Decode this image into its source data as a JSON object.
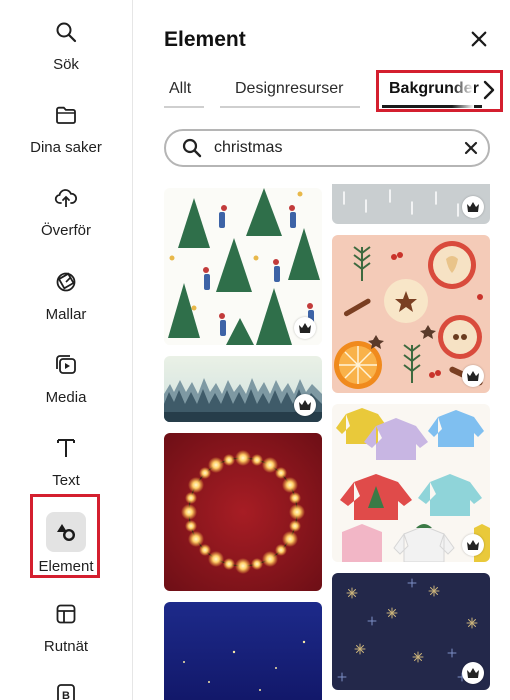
{
  "sidebar": {
    "items": [
      {
        "label": "Sök",
        "icon": "search-icon"
      },
      {
        "label": "Dina saker",
        "icon": "folder-icon"
      },
      {
        "label": "Överför",
        "icon": "cloud-upload-icon"
      },
      {
        "label": "Mallar",
        "icon": "templates-icon"
      },
      {
        "label": "Media",
        "icon": "media-icon"
      },
      {
        "label": "Text",
        "icon": "text-icon"
      },
      {
        "label": "Element",
        "icon": "shapes-icon",
        "active": true
      },
      {
        "label": "Rutnät",
        "icon": "grid-layout-icon"
      },
      {
        "label": "",
        "icon": "brand-icon"
      }
    ]
  },
  "panel": {
    "title": "Element",
    "close_icon": "close-icon",
    "tabs": [
      {
        "label": "Allt"
      },
      {
        "label": "Designresurser"
      },
      {
        "label": "Bakgrunder",
        "active": true
      }
    ],
    "next_icon": "chevron-right-icon"
  },
  "search": {
    "value": "christmas",
    "icon": "search-icon",
    "clear_icon": "clear-icon"
  },
  "results": [
    {
      "name": "christmas-trees-people-pattern",
      "premium": true
    },
    {
      "name": "winter-forest-banner",
      "premium": true
    },
    {
      "name": "fairy-lights-wreath-red",
      "premium": false
    },
    {
      "name": "starry-night-blue",
      "premium": false
    },
    {
      "name": "snowy-grey-pattern",
      "premium": true
    },
    {
      "name": "apples-oranges-spices-pattern",
      "premium": true
    },
    {
      "name": "christmas-sweaters-pattern",
      "premium": true
    },
    {
      "name": "navy-snowflake-pattern",
      "premium": true
    }
  ],
  "colors": {
    "accent_highlight": "#d41f2f",
    "active_bg": "#e3e3e3",
    "text": "#1a1a1a"
  }
}
